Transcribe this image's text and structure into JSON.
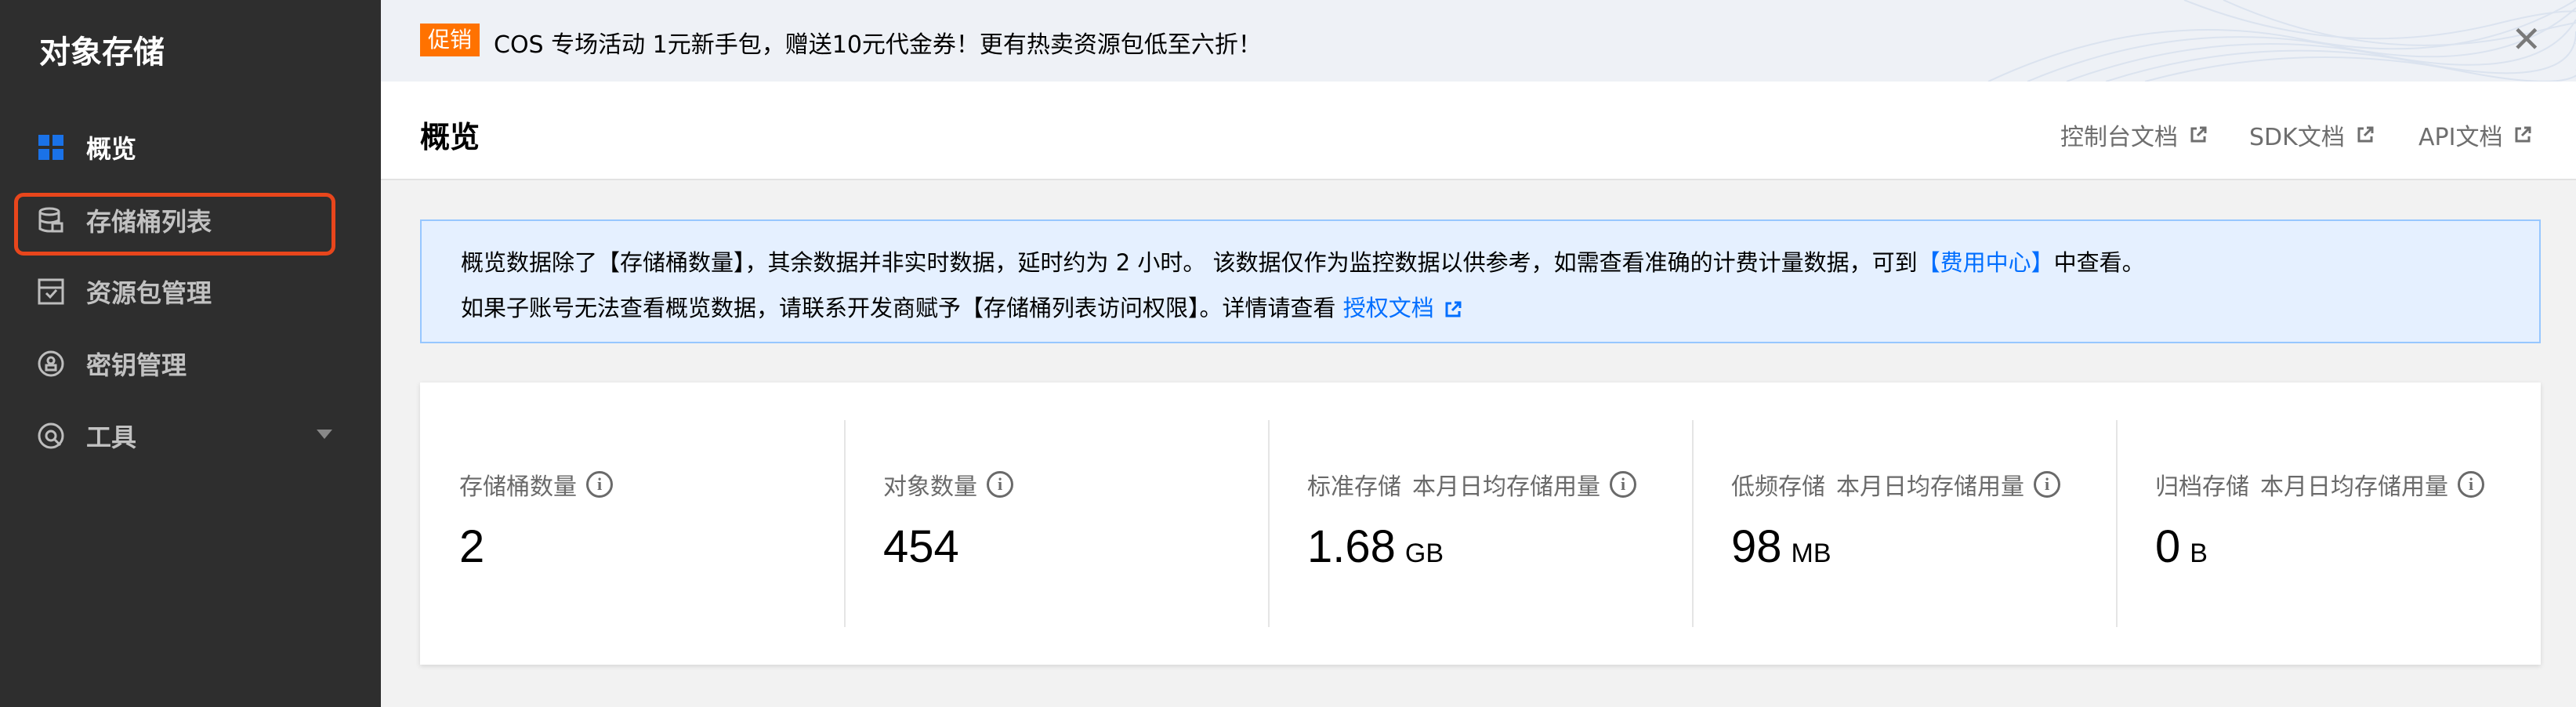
{
  "sidebar": {
    "title": "对象存储",
    "items": [
      {
        "label": "概览",
        "icon": "grid-icon",
        "active": true
      },
      {
        "label": "存储桶列表",
        "icon": "bucket-icon"
      },
      {
        "label": "资源包管理",
        "icon": "package-icon"
      },
      {
        "label": "密钥管理",
        "icon": "key-icon"
      },
      {
        "label": "工具",
        "icon": "tool-icon"
      }
    ]
  },
  "promo": {
    "tag": "促销",
    "text": "COS 专场活动 1元新手包，赠送10元代金券！更有热卖资源包低至六折！",
    "close": "✕"
  },
  "header": {
    "title": "概览",
    "links": [
      "控制台文档",
      "SDK文档",
      "API文档"
    ]
  },
  "notice": {
    "line1_a": "概览数据除了【存储桶数量】，其余数据并非实时数据，延时约为 2 小时。 该数据仅作为监控数据以供参考，如需查看准确的计费计量数据，可到",
    "line1_link": "【费用中心】",
    "line1_b": "中查看。",
    "line2_a": "如果子账号无法查看概览数据，请联系开发商赋予【存储桶列表访问权限】。详情请查看",
    "line2_link": "授权文档"
  },
  "stats": [
    {
      "label": "存储桶数量",
      "sub": "",
      "value": "2",
      "unit": ""
    },
    {
      "label": "对象数量",
      "sub": "",
      "value": "454",
      "unit": ""
    },
    {
      "label": "标准存储",
      "sub": "本月日均存储用量",
      "value": "1.68",
      "unit": "GB"
    },
    {
      "label": "低频存储",
      "sub": "本月日均存储用量",
      "value": "98",
      "unit": "MB"
    },
    {
      "label": "归档存储",
      "sub": "本月日均存储用量",
      "value": "0",
      "unit": "B"
    }
  ],
  "colors": {
    "accent": "#006eff",
    "highlight": "#e8461c",
    "promo_tag": "#ff7200"
  }
}
